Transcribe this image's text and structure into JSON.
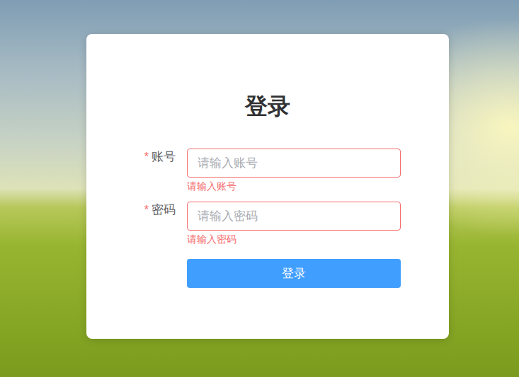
{
  "page": {
    "title": "登录"
  },
  "fields": [
    {
      "label": "账号",
      "mark": "*",
      "required": true,
      "placeholder": "请输入账号",
      "value": "",
      "error": "请输入账号",
      "type": "text"
    },
    {
      "label": "密码",
      "mark": "*",
      "required": true,
      "placeholder": "请输入密码",
      "value": "",
      "error": "请输入密码",
      "type": "password"
    }
  ],
  "button": {
    "label": "登录"
  }
}
